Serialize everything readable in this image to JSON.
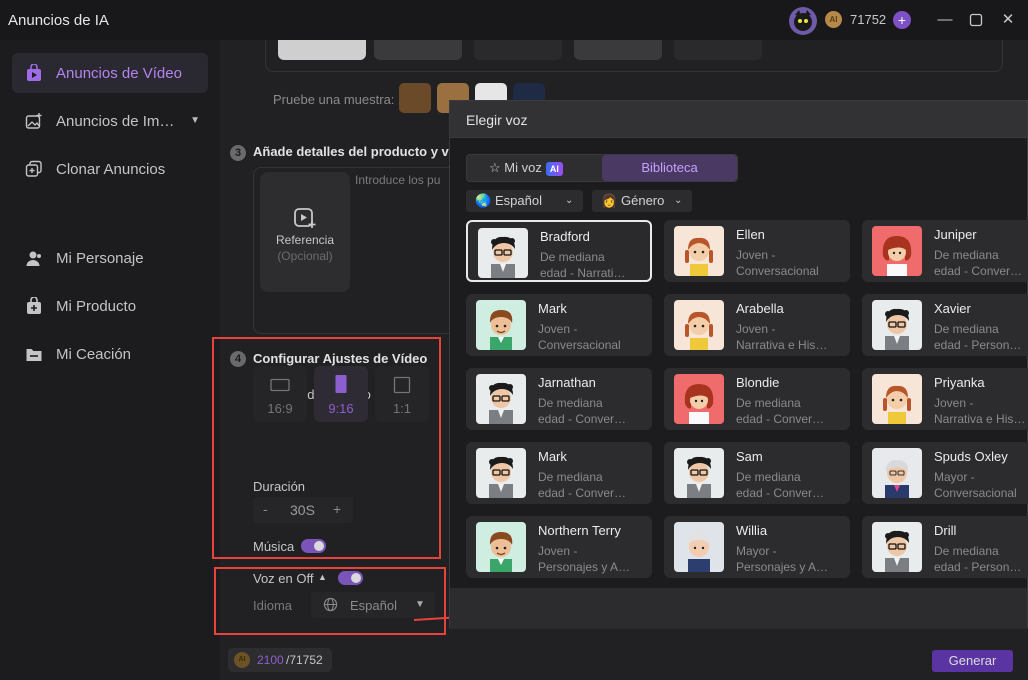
{
  "app": {
    "title": "Anuncios de IA",
    "coins": "71752"
  },
  "sidebar": {
    "items": [
      {
        "label": "Anuncios de Vídeo",
        "icon": "video-bag-icon"
      },
      {
        "label": "Anuncios de Im…",
        "icon": "image-add-icon"
      },
      {
        "label": "Clonar Anuncios",
        "icon": "clone-icon"
      },
      {
        "label": "Mi Personaje",
        "icon": "person-icon"
      },
      {
        "label": "Mi Producto",
        "icon": "product-icon"
      },
      {
        "label": "Mi Ceación",
        "icon": "folder-icon"
      }
    ]
  },
  "main": {
    "sample_label": "Pruebe una muestra:",
    "step3": {
      "num": "3",
      "title": "Añade detalles del producto y v",
      "ref_label": "Referencia",
      "ref_sub": "(Opcional)",
      "placeholder": "Introduce los pu"
    },
    "step4": {
      "num": "4",
      "title": "Configurar Ajustes de Vídeo",
      "aspect_label": "Relación de aspecto",
      "ratios": [
        "16:9",
        "9:16",
        "1:1"
      ],
      "ratio_selected": "9:16",
      "duration_label": "Duración",
      "duration_value": "30S",
      "minus": "-",
      "plus": "+",
      "music_label": "Música",
      "music_on": true,
      "voiceover_label": "Voz en Off",
      "voiceover_on": true,
      "language_label": "Idioma",
      "language_value": "Español"
    },
    "cost_used": "2100",
    "cost_total": "/71752",
    "generate": "Generar"
  },
  "dialog": {
    "title": "Elegir voz",
    "tabs": {
      "my_voice": "Mi voz",
      "ai_badge": "AI",
      "library": "Biblioteca"
    },
    "filters": {
      "language": "Español",
      "gender": "Género"
    },
    "voices": [
      {
        "name": "Bradford",
        "desc1": "De mediana",
        "desc2": "edad - Narrati…",
        "avatar": "man-glasses"
      },
      {
        "name": "Ellen",
        "desc1": "Joven -",
        "desc2": "Conversacional",
        "avatar": "girl-braids"
      },
      {
        "name": "Juniper",
        "desc1": "De mediana",
        "desc2": "edad - Conver…",
        "avatar": "woman-red"
      },
      {
        "name": "Mark",
        "desc1": "Joven -",
        "desc2": "Conversacional",
        "avatar": "boy-green"
      },
      {
        "name": "Arabella",
        "desc1": "Joven -",
        "desc2": "Narrativa e His…",
        "avatar": "girl-braids"
      },
      {
        "name": "Xavier",
        "desc1": "De mediana",
        "desc2": "edad - Person…",
        "avatar": "man-glasses"
      },
      {
        "name": "Jarnathan",
        "desc1": "De mediana",
        "desc2": "edad - Conver…",
        "avatar": "man-glasses"
      },
      {
        "name": "Blondie",
        "desc1": "De mediana",
        "desc2": "edad - Conver…",
        "avatar": "woman-red"
      },
      {
        "name": "Priyanka",
        "desc1": "Joven -",
        "desc2": "Narrativa e His…",
        "avatar": "girl-braids"
      },
      {
        "name": "Mark",
        "desc1": "De mediana",
        "desc2": "edad - Conver…",
        "avatar": "man-glasses"
      },
      {
        "name": "Sam",
        "desc1": "De mediana",
        "desc2": "edad - Conver…",
        "avatar": "man-glasses"
      },
      {
        "name": "Spuds Oxley",
        "desc1": "Mayor -",
        "desc2": "Conversacional",
        "avatar": "grandpa"
      },
      {
        "name": "Northern Terry",
        "desc1": "Joven -",
        "desc2": "Personajes y A…",
        "avatar": "boy-green"
      },
      {
        "name": "Willia",
        "desc1": "Mayor -",
        "desc2": "Personajes y A…",
        "avatar": "grandma"
      },
      {
        "name": "Drill",
        "desc1": "De mediana",
        "desc2": "edad - Person…",
        "avatar": "man-glasses"
      }
    ],
    "selected_index": 0
  },
  "colors": {
    "accent": "#8c5ecf",
    "highlight": "#e8433b"
  }
}
